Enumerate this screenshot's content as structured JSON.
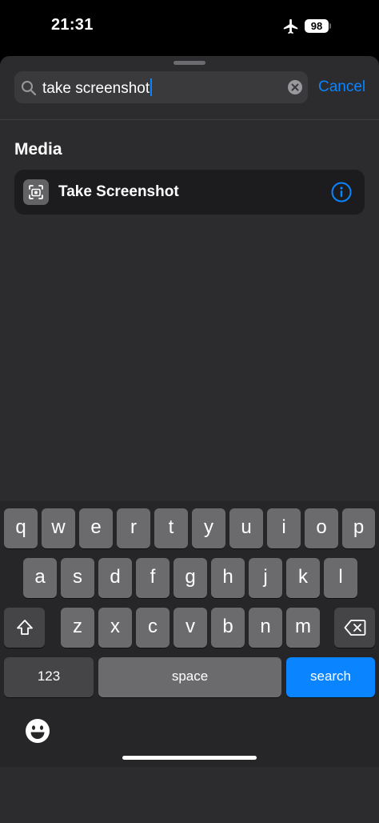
{
  "status_bar": {
    "time": "21:31",
    "battery": "98"
  },
  "search": {
    "query": "take screenshot",
    "cancel_label": "Cancel"
  },
  "results": {
    "section_title": "Media",
    "items": [
      {
        "label": "Take Screenshot"
      }
    ]
  },
  "keyboard": {
    "row1": [
      "q",
      "w",
      "e",
      "r",
      "t",
      "y",
      "u",
      "i",
      "o",
      "p"
    ],
    "row2": [
      "a",
      "s",
      "d",
      "f",
      "g",
      "h",
      "j",
      "k",
      "l"
    ],
    "row3": [
      "z",
      "x",
      "c",
      "v",
      "b",
      "n",
      "m"
    ],
    "numbers_label": "123",
    "space_label": "space",
    "return_label": "search"
  },
  "colors": {
    "accent": "#0a84ff",
    "sheet": "#2c2c2e",
    "key": "#6b6b6e"
  }
}
